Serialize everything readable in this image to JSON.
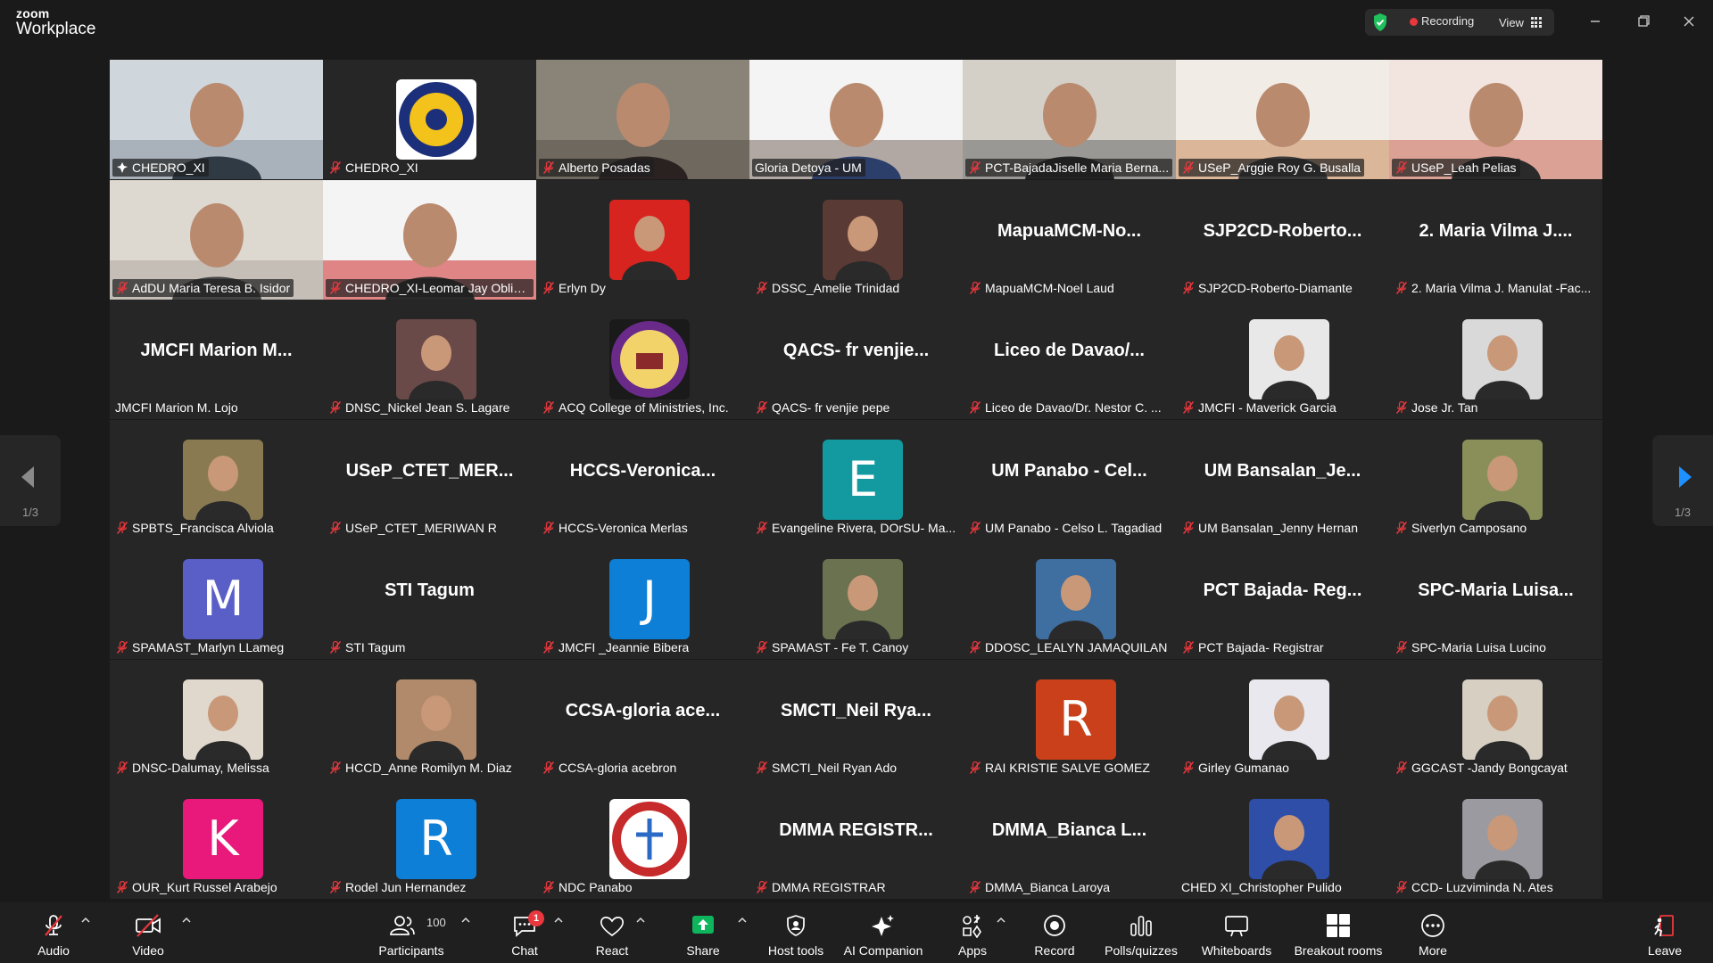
{
  "app": {
    "logo_top": "zoom",
    "logo_bottom": "Workplace"
  },
  "titlebar": {
    "recording_label": "Recording",
    "view_label": "View",
    "status_color": "#20c05c",
    "recording_color": "#e8383d"
  },
  "pagination": {
    "prev_page_label": "1/3",
    "next_page_label": "1/3",
    "arrow_color": "#1e90ff"
  },
  "participants": [
    {
      "name": "CHEDRO_XI",
      "kind": "video",
      "active": true,
      "muted": false
    },
    {
      "name": "CHEDRO_XI",
      "kind": "logo-ched",
      "muted": true
    },
    {
      "name": "Alberto Posadas",
      "kind": "video",
      "muted": true
    },
    {
      "name": "Gloria Detoya - UM",
      "kind": "video",
      "muted": false
    },
    {
      "name": "PCT-BajadaJiselle Maria Berna...",
      "kind": "video",
      "muted": true
    },
    {
      "name": "USeP_Arggie Roy G. Busalla",
      "kind": "video",
      "muted": true
    },
    {
      "name": "USeP_Leah Pelias",
      "kind": "video",
      "muted": true
    },
    {
      "name": "AdDU Maria Teresa B. Isidor",
      "kind": "video",
      "muted": true
    },
    {
      "name": "CHEDRO_XI-Leomar Jay Oblia...",
      "kind": "video",
      "muted": true
    },
    {
      "name": "Erlyn Dy",
      "kind": "photo",
      "photo_color": "#d8241f",
      "muted": true
    },
    {
      "name": "DSSC_Amelie Trinidad",
      "kind": "photo",
      "photo_color": "#5a3a34",
      "muted": true
    },
    {
      "name": "MapuaMCM-Noel Laud",
      "big": "MapuaMCM-No...",
      "kind": "text",
      "muted": true
    },
    {
      "name": "SJP2CD-Roberto-Diamante",
      "big": "SJP2CD-Roberto...",
      "kind": "text",
      "muted": true
    },
    {
      "name": "2. Maria Vilma J. Manulat -Fac...",
      "big": "2. Maria Vilma J....",
      "kind": "text",
      "muted": true
    },
    {
      "name": "JMCFI Marion M. Lojo",
      "big": "JMCFI Marion M...",
      "kind": "text",
      "muted": false
    },
    {
      "name": "DNSC_Nickel Jean S. Lagare",
      "kind": "photo",
      "photo_color": "#6a4a48",
      "muted": true
    },
    {
      "name": "ACQ College of Ministries, Inc.",
      "kind": "logo-acq",
      "muted": true
    },
    {
      "name": "QACS- fr venjie pepe",
      "big": "QACS- fr venjie...",
      "kind": "text",
      "muted": true
    },
    {
      "name": "Liceo de Davao/Dr. Nestor C. ...",
      "big": "Liceo de Davao/...",
      "kind": "text",
      "muted": true
    },
    {
      "name": "JMCFI - Maverick Garcia",
      "kind": "photo",
      "photo_color": "#e8e8e8",
      "muted": true
    },
    {
      "name": "Jose Jr. Tan",
      "kind": "photo",
      "photo_color": "#d9d9d9",
      "muted": true
    },
    {
      "name": "SPBTS_Francisca Alviola",
      "kind": "photo",
      "photo_color": "#8a7a52",
      "muted": true
    },
    {
      "name": "USeP_CTET_MERIWAN R",
      "big": "USeP_CTET_MER...",
      "kind": "text",
      "muted": true
    },
    {
      "name": "HCCS-Veronica Merlas",
      "big": "HCCS-Veronica...",
      "kind": "text",
      "muted": true
    },
    {
      "name": "Evangeline Rivera, DOrSU- Ma...",
      "kind": "letter",
      "letter": "E",
      "letter_color": "#139aa0",
      "muted": true
    },
    {
      "name": "UM Panabo - Celso L. Tagadiad",
      "big": "UM Panabo - Cel...",
      "kind": "text",
      "muted": true
    },
    {
      "name": "UM Bansalan_Jenny Hernan",
      "big": "UM Bansalan_Je...",
      "kind": "text",
      "muted": true
    },
    {
      "name": "Siverlyn Camposano",
      "kind": "photo",
      "photo_color": "#8a8f5a",
      "muted": true
    },
    {
      "name": "SPAMAST_Marlyn LLameg",
      "kind": "letter",
      "letter": "M",
      "letter_color": "#5a5fc8",
      "muted": true
    },
    {
      "name": "STI Tagum",
      "big": "STI Tagum",
      "kind": "text",
      "muted": true
    },
    {
      "name": "JMCFI _Jeannie Bibera",
      "kind": "letter",
      "letter": "J",
      "letter_color": "#0e7fd6",
      "muted": true
    },
    {
      "name": "SPAMAST - Fe T. Canoy",
      "kind": "photo",
      "photo_color": "#6b7250",
      "muted": true
    },
    {
      "name": "DDOSC_LEALYN JAMAQUILAN",
      "kind": "photo",
      "photo_color": "#3f6ea0",
      "muted": true
    },
    {
      "name": "PCT Bajada- Registrar",
      "big": "PCT Bajada- Reg...",
      "kind": "text",
      "muted": true
    },
    {
      "name": "SPC-Maria Luisa Lucino",
      "big": "SPC-Maria Luisa...",
      "kind": "text",
      "muted": true
    },
    {
      "name": "DNSC-Dalumay, Melissa",
      "kind": "photo",
      "photo_color": "#e0d8cc",
      "muted": true
    },
    {
      "name": "HCCD_Anne Romilyn M. Diaz",
      "kind": "photo",
      "photo_color": "#b08a6a",
      "muted": true
    },
    {
      "name": "CCSA-gloria acebron",
      "big": "CCSA-gloria ace...",
      "kind": "text",
      "muted": true
    },
    {
      "name": "SMCTI_Neil Ryan Ado",
      "big": "SMCTI_Neil Rya...",
      "kind": "text",
      "muted": true
    },
    {
      "name": "RAI KRISTIE SALVE GOMEZ",
      "kind": "letter",
      "letter": "R",
      "letter_color": "#c9401b",
      "muted": true
    },
    {
      "name": "Girley Gumanao",
      "kind": "photo",
      "photo_color": "#e8e8ee",
      "muted": true
    },
    {
      "name": "GGCAST -Jandy Bongcayat",
      "kind": "photo",
      "photo_color": "#d6cfc2",
      "muted": true
    },
    {
      "name": "OUR_Kurt Russel Arabejo",
      "kind": "letter",
      "letter": "K",
      "letter_color": "#e8197a",
      "muted": true
    },
    {
      "name": "Rodel Jun Hernandez",
      "kind": "letter",
      "letter": "R",
      "letter_color": "#0e7fd6",
      "muted": true
    },
    {
      "name": "NDC Panabo",
      "kind": "logo-ndc",
      "muted": true
    },
    {
      "name": "DMMA REGISTRAR",
      "big": "DMMA  REGISTR...",
      "kind": "text",
      "muted": true
    },
    {
      "name": "DMMA_Bianca Laroya",
      "big": "DMMA_Bianca L...",
      "kind": "text",
      "muted": true
    },
    {
      "name": "CHED XI_Christopher Pulido",
      "kind": "photo",
      "photo_color": "#2f4ea8",
      "muted": false
    },
    {
      "name": "CCD- Luzviminda N. Ates",
      "kind": "photo",
      "photo_color": "#9a9aa0",
      "muted": true
    }
  ],
  "toolbar": {
    "audio": "Audio",
    "video": "Video",
    "participants": "Participants",
    "participant_count": "100",
    "chat": "Chat",
    "chat_badge": "1",
    "react": "React",
    "share": "Share",
    "host_tools": "Host tools",
    "ai_companion": "AI Companion",
    "apps": "Apps",
    "record": "Record",
    "polls": "Polls/quizzes",
    "whiteboards": "Whiteboards",
    "breakout": "Breakout rooms",
    "more": "More",
    "leave": "Leave",
    "share_color": "#0eb55c",
    "off_color": "#e8383d"
  }
}
